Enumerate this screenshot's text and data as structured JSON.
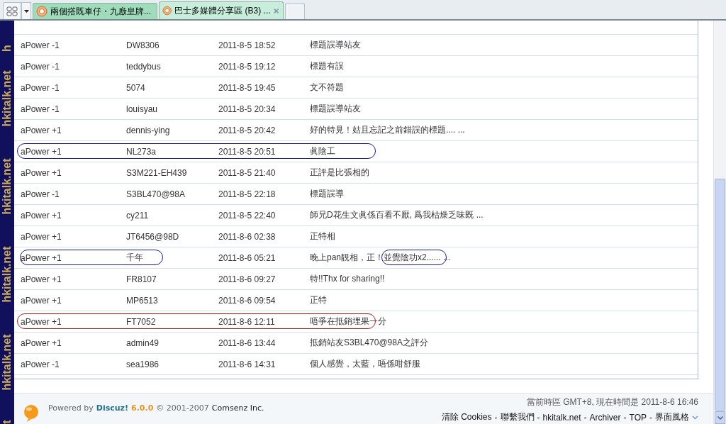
{
  "tabs": [
    {
      "title": "兩個撘既車仔・九廒皇牌...",
      "selected": false,
      "closable": false
    },
    {
      "title": "巴士多媒體分享區 (B3) ...",
      "selected": true,
      "closable": true
    }
  ],
  "side_banner": [
    "h",
    "hkitalk.net",
    "hkitalk.net",
    "hkitalk.net",
    "hkitalk.net",
    "t"
  ],
  "rating_rows": [
    {
      "score": "aPower -1",
      "user": "DW8306",
      "time": "2011-8-5 18:52",
      "reason": "標題誤導站友"
    },
    {
      "score": "aPower -1",
      "user": "teddybus",
      "time": "2011-8-5 19:12",
      "reason": "標題有誤"
    },
    {
      "score": "aPower -1",
      "user": "5074",
      "time": "2011-8-5 19:45",
      "reason": "文不符題"
    },
    {
      "score": "aPower -1",
      "user": "louisyau",
      "time": "2011-8-5 20:34",
      "reason": "標題誤導站友"
    },
    {
      "score": "aPower +1",
      "user": "dennis-ying",
      "time": "2011-8-5 20:42",
      "reason": "好的特見！姑且忘記之前錯誤的標題.... ..."
    },
    {
      "score": "aPower +1",
      "user": "NL273a",
      "time": "2011-8-5 20:51",
      "reason": "眞陰工",
      "ring": {
        "kind": "row",
        "color": "#1a1a8c"
      }
    },
    {
      "score": "aPower +1",
      "user": "S3M221-EH439",
      "time": "2011-8-5 21:40",
      "reason": "正評是比張相的"
    },
    {
      "score": "aPower -1",
      "user": "S3BL470@98A",
      "time": "2011-8-5 22:18",
      "reason": "標題誤導"
    },
    {
      "score": "aPower +1",
      "user": "cy211",
      "time": "2011-8-5 22:40",
      "reason": "師兄D花生文眞係百看不厭, 爲我枯燥乏味既 ..."
    },
    {
      "score": "aPower +1",
      "user": "JT6456@98D",
      "time": "2011-8-6 02:38",
      "reason": "正特相"
    },
    {
      "score": "aPower +1",
      "user": "千年",
      "time": "2011-8-6 05:21",
      "reason": "晚上pan靚相，正！並覺陰功x2...... ...",
      "ring": {
        "kind": "name",
        "color": "#1a1a8c"
      },
      "ring2": {
        "kind": "comment",
        "color": "#1a1a8c"
      }
    },
    {
      "score": "aPower +1",
      "user": "FR8107",
      "time": "2011-8-6 09:27",
      "reason": "特!!Thx for sharing!!"
    },
    {
      "score": "aPower +1",
      "user": "MP6513",
      "time": "2011-8-6 09:54",
      "reason": "正特"
    },
    {
      "score": "aPower +1",
      "user": "FT7052",
      "time": "2011-8-6 12:11",
      "reason": "唔爭在抵銷埋果一分",
      "ring": {
        "kind": "row",
        "color": "#b02020"
      }
    },
    {
      "score": "aPower +1",
      "user": "admin49",
      "time": "2011-8-6 13:44",
      "reason": "抵銷站友S3BL470@98A之評分"
    },
    {
      "score": "aPower -1",
      "user": "sea1986",
      "time": "2011-8-6 14:31",
      "reason": "個人感覺，太藍，唔係咁舒服"
    }
  ],
  "footer": {
    "powered": "Powered by",
    "brand": "Discuz!",
    "version": "6.0.0",
    "copyright": "© 2001-2007",
    "company": "Comsenz Inc.",
    "time_note": "當前時區 GMT+8, 現在時間是 2011-8-6 16:46",
    "links": [
      "清除 Cookies",
      "聯繫我們",
      "hkitalk.net",
      "Archiver",
      "TOP",
      "界面風格"
    ],
    "separator": "-"
  }
}
